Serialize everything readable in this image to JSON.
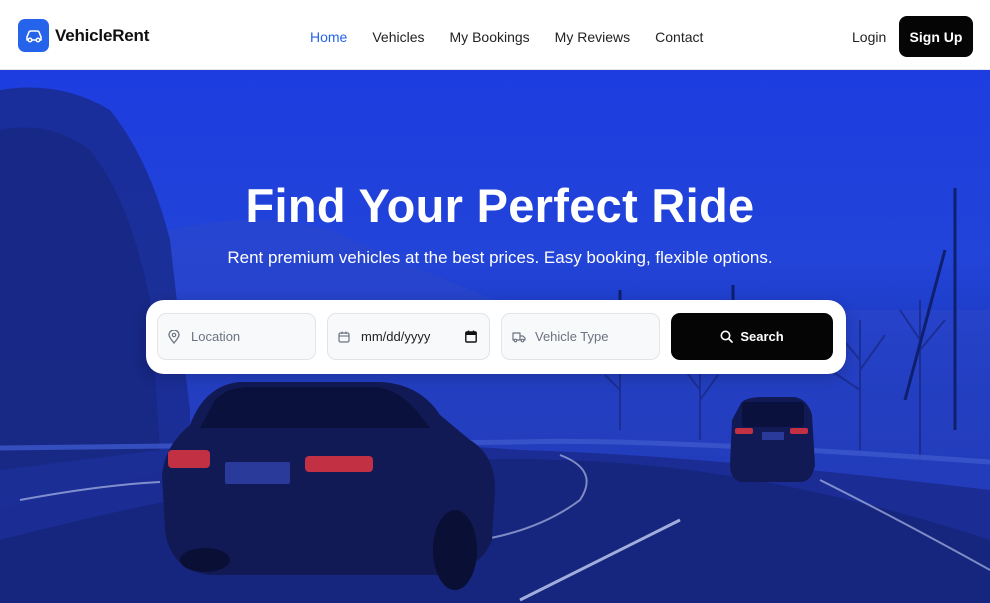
{
  "brand": {
    "name": "VehicleRent",
    "logo_icon": "car-icon",
    "accent": "#2563eb"
  },
  "nav": {
    "items": [
      {
        "label": "Home",
        "active": true
      },
      {
        "label": "Vehicles",
        "active": false
      },
      {
        "label": "My Bookings",
        "active": false
      },
      {
        "label": "My Reviews",
        "active": false
      },
      {
        "label": "Contact",
        "active": false
      }
    ],
    "login_label": "Login",
    "signup_label": "Sign Up"
  },
  "hero": {
    "title": "Find Your Perfect Ride",
    "subtitle": "Rent premium vehicles at the best prices. Easy booking, flexible options."
  },
  "search": {
    "location_placeholder": "Location",
    "date_placeholder": "mm/dd/yyyy",
    "vehicle_type_placeholder": "Vehicle Type",
    "button_label": "Search"
  }
}
